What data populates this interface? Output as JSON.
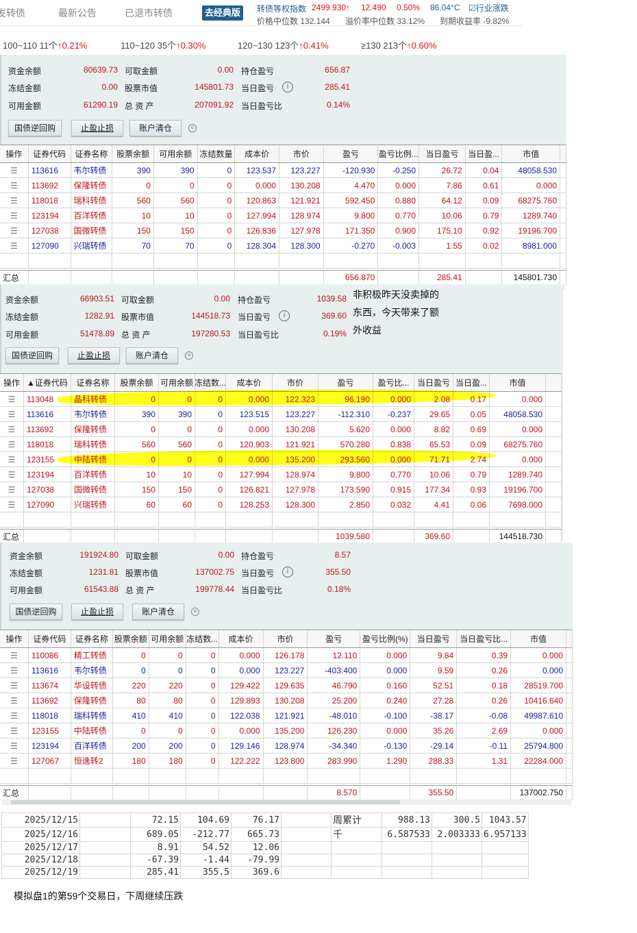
{
  "header": {
    "tabs": [
      "发转债",
      "最新公告",
      "已退市转债"
    ],
    "classic_button": "去经典版",
    "index_label": "转债等权指数",
    "index_value": "2499.930↑",
    "index_change": "12.490",
    "index_pct": "0.50%",
    "temperature": "86.04°C",
    "industry_link": "行业涨跌",
    "median_price": "价格中位数 132.144",
    "median_premium": "溢价率中位数 33.12%",
    "ytm": "到期收益率 -9.82%"
  },
  "ranges": [
    {
      "label": "100~110 11个",
      "change": "↑0.21%"
    },
    {
      "label": "110~120 35个",
      "change": "↑0.30%"
    },
    {
      "label": "120~130 123个",
      "change": "↑0.41%"
    },
    {
      "label": "≥130 213个",
      "change": "↑0.60%"
    }
  ],
  "labels": {
    "cash": "资金余额",
    "withdrawable": "可取金额",
    "hold_pl": "持仓盈亏",
    "frozen": "冻结金额",
    "stock_value": "股票市值",
    "day_pl": "当日盈亏",
    "available": "可用金额",
    "total": "总 资 产",
    "day_pl_pct": "当日盈亏比",
    "btn_repo": "国债逆回购",
    "btn_stop": "止盈止损",
    "btn_clear": "账户清仓",
    "sum_label": "汇总"
  },
  "accounts": [
    {
      "cash": "80639.73",
      "withdrawable": "0.00",
      "hold_pl": "656.87",
      "frozen": "0.00",
      "stock_value": "145801.73",
      "day_pl": "285.41",
      "available": "61290.19",
      "total": "207091.92",
      "day_pl_pct": "0.14%",
      "headers": [
        "操作",
        "证券代码",
        "证券名称",
        "股票余额",
        "可用余额",
        "冻结数量",
        "成本价",
        "市价",
        "盈亏",
        "盈亏比例...",
        "当日盈亏",
        "当日盈...",
        "市值"
      ],
      "rows": [
        [
          "113616",
          "韦尔转债",
          "390",
          "390",
          "0",
          "123.537",
          "123.227",
          "-120.930",
          "-0.250",
          "26.72",
          "0.04",
          "48058.530"
        ],
        [
          "113692",
          "保隆转债",
          "0",
          "0",
          "0",
          "0.000",
          "130.208",
          "4.470",
          "0.000",
          "7.86",
          "0.61",
          "0.000"
        ],
        [
          "118018",
          "瑞科转债",
          "560",
          "560",
          "0",
          "120.863",
          "121.921",
          "592.450",
          "0.880",
          "64.12",
          "0.09",
          "68275.760"
        ],
        [
          "123194",
          "百洋转债",
          "10",
          "10",
          "0",
          "127.994",
          "128.974",
          "9.800",
          "0.770",
          "10.06",
          "0.79",
          "1289.740"
        ],
        [
          "127038",
          "国微转债",
          "150",
          "150",
          "0",
          "126.836",
          "127.978",
          "171.350",
          "0.900",
          "175.10",
          "0.92",
          "19196.700"
        ],
        [
          "127090",
          "兴瑞转债",
          "70",
          "70",
          "0",
          "128.304",
          "128.300",
          "-0.270",
          "-0.003",
          "1.55",
          "0.02",
          "8981.000"
        ]
      ],
      "totals": {
        "pl": "656.870",
        "day": "285.41",
        "mv": "145801.730"
      }
    },
    {
      "cash": "66903.51",
      "withdrawable": "0.00",
      "hold_pl": "1039.58",
      "frozen": "1282.91",
      "stock_value": "144518.73",
      "day_pl": "369.60",
      "available": "51478.89",
      "total": "197280.53",
      "day_pl_pct": "0.19%",
      "note": [
        "非积极昨天没卖掉的",
        "东西，今天带来了额",
        "外收益"
      ],
      "headers": [
        "操作",
        "▲证券代码",
        "证券名称",
        "股票余额",
        "可用余额",
        "冻结数...",
        "成本价",
        "市价",
        "盈亏",
        "盈亏比...",
        "当日盈亏",
        "当日盈...",
        "市值"
      ],
      "rows": [
        [
          "113048",
          "晶科转债",
          "0",
          "0",
          "0",
          "0.000",
          "122.323",
          "96.190",
          "0.000",
          "2.08",
          "0.17",
          "0.000"
        ],
        [
          "113616",
          "韦尔转债",
          "390",
          "390",
          "0",
          "123.515",
          "123.227",
          "-112.310",
          "-0.237",
          "29.65",
          "0.05",
          "48058.530"
        ],
        [
          "113692",
          "保隆转债",
          "0",
          "0",
          "0",
          "0.000",
          "130.208",
          "5.620",
          "0.000",
          "8.82",
          "0.69",
          "0.000"
        ],
        [
          "118018",
          "瑞科转债",
          "560",
          "560",
          "0",
          "120.903",
          "121.921",
          "570.280",
          "0.838",
          "65.53",
          "0.09",
          "68275.760"
        ],
        [
          "123155",
          "中陆转债",
          "0",
          "0",
          "0",
          "0.000",
          "135.200",
          "293.560",
          "0.000",
          "71.71",
          "2.74",
          "0.000"
        ],
        [
          "123194",
          "百洋转债",
          "10",
          "10",
          "0",
          "127.994",
          "128.974",
          "9.800",
          "0.770",
          "10.06",
          "0.79",
          "1289.740"
        ],
        [
          "127038",
          "国微转债",
          "150",
          "150",
          "0",
          "126.821",
          "127.978",
          "173.590",
          "0.915",
          "177.34",
          "0.93",
          "19196.700"
        ],
        [
          "127090",
          "兴瑞转债",
          "60",
          "60",
          "0",
          "128.253",
          "128.300",
          "2.850",
          "0.032",
          "4.41",
          "0.06",
          "7698.000"
        ]
      ],
      "totals": {
        "pl": "1039.580",
        "day": "369.60",
        "mv": "144518.730"
      }
    },
    {
      "cash": "191924.80",
      "withdrawable": "0.00",
      "hold_pl": "8.57",
      "frozen": "1231.81",
      "stock_value": "137002.75",
      "day_pl": "355.50",
      "available": "61543.88",
      "total": "199778.44",
      "day_pl_pct": "0.18%",
      "headers": [
        "操作",
        "证券代码",
        "证券名称",
        "股票余额",
        "可用余额",
        "冻结数...",
        "成本价",
        "市价",
        "盈亏",
        "盈亏比例(%)",
        "当日盈亏",
        "当日盈亏比...",
        "市值"
      ],
      "rows": [
        [
          "110086",
          "精工转债",
          "0",
          "0",
          "0",
          "0.000",
          "126.178",
          "12.110",
          "0.000",
          "9.84",
          "0.39",
          "0.000"
        ],
        [
          "113616",
          "韦尔转债",
          "0",
          "0",
          "0",
          "0.000",
          "123.227",
          "-403.400",
          "0.000",
          "9.59",
          "0.26",
          "0.000"
        ],
        [
          "113674",
          "华设转债",
          "220",
          "220",
          "0",
          "129.422",
          "129.635",
          "46.790",
          "0.160",
          "52.51",
          "0.18",
          "28519.700"
        ],
        [
          "113692",
          "保隆转债",
          "80",
          "80",
          "0",
          "129.893",
          "130.208",
          "25.200",
          "0.240",
          "27.28",
          "0.26",
          "10416.640"
        ],
        [
          "118018",
          "瑞科转债",
          "410",
          "410",
          "0",
          "122.038",
          "121.921",
          "-48.010",
          "-0.100",
          "-38.17",
          "-0.08",
          "49987.610"
        ],
        [
          "123155",
          "中陆转债",
          "0",
          "0",
          "0",
          "0.000",
          "135.200",
          "126.230",
          "0.000",
          "35.26",
          "2.69",
          "0.000"
        ],
        [
          "123194",
          "百洋转债",
          "200",
          "200",
          "0",
          "129.146",
          "128.974",
          "-34.340",
          "-0.130",
          "-29.14",
          "-0.11",
          "25794.800"
        ],
        [
          "127067",
          "恒逸转2",
          "180",
          "180",
          "0",
          "122.222",
          "123.800",
          "283.990",
          "1.290",
          "288.33",
          "1.31",
          "22284.000"
        ]
      ],
      "totals": {
        "pl": "8.570",
        "day": "355.50",
        "mv": "137002.750"
      }
    }
  ],
  "sheet": {
    "rows": [
      [
        "2025/12/15",
        "",
        "72.15",
        "104.69",
        "76.17",
        "",
        "周累计",
        "988.13",
        "300.5",
        "1043.57"
      ],
      [
        "2025/12/16",
        "",
        "689.05",
        "-212.77",
        "665.73",
        "",
        "千",
        "6.587533",
        "2.003333",
        "6.957133"
      ],
      [
        "2025/12/17",
        "",
        "8.91",
        "54.52",
        "12.06",
        "",
        "",
        "",
        "",
        ""
      ],
      [
        "2025/12/18",
        "",
        "-67.39",
        "-1.44",
        "-79.99",
        "",
        "",
        "",
        "",
        ""
      ],
      [
        "2025/12/19",
        "",
        "285.41",
        "355.5",
        "369.6",
        "",
        "",
        "",
        "",
        ""
      ]
    ]
  },
  "footer": "模拟盘1的第59个交易日，下周继续压跌"
}
